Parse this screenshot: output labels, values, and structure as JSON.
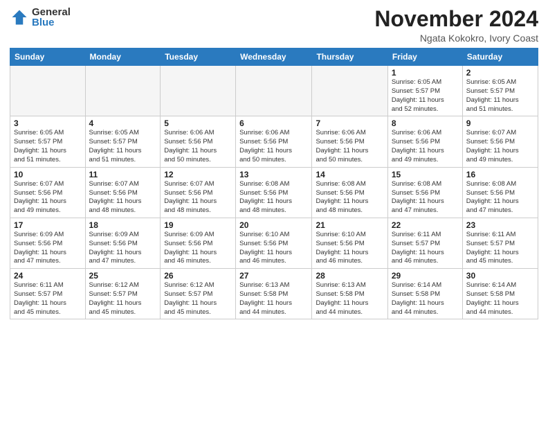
{
  "logo": {
    "general": "General",
    "blue": "Blue"
  },
  "title": "November 2024",
  "location": "Ngata Kokokro, Ivory Coast",
  "weekdays": [
    "Sunday",
    "Monday",
    "Tuesday",
    "Wednesday",
    "Thursday",
    "Friday",
    "Saturday"
  ],
  "weeks": [
    [
      {
        "day": "",
        "info": ""
      },
      {
        "day": "",
        "info": ""
      },
      {
        "day": "",
        "info": ""
      },
      {
        "day": "",
        "info": ""
      },
      {
        "day": "",
        "info": ""
      },
      {
        "day": "1",
        "info": "Sunrise: 6:05 AM\nSunset: 5:57 PM\nDaylight: 11 hours\nand 52 minutes."
      },
      {
        "day": "2",
        "info": "Sunrise: 6:05 AM\nSunset: 5:57 PM\nDaylight: 11 hours\nand 51 minutes."
      }
    ],
    [
      {
        "day": "3",
        "info": "Sunrise: 6:05 AM\nSunset: 5:57 PM\nDaylight: 11 hours\nand 51 minutes."
      },
      {
        "day": "4",
        "info": "Sunrise: 6:05 AM\nSunset: 5:57 PM\nDaylight: 11 hours\nand 51 minutes."
      },
      {
        "day": "5",
        "info": "Sunrise: 6:06 AM\nSunset: 5:56 PM\nDaylight: 11 hours\nand 50 minutes."
      },
      {
        "day": "6",
        "info": "Sunrise: 6:06 AM\nSunset: 5:56 PM\nDaylight: 11 hours\nand 50 minutes."
      },
      {
        "day": "7",
        "info": "Sunrise: 6:06 AM\nSunset: 5:56 PM\nDaylight: 11 hours\nand 50 minutes."
      },
      {
        "day": "8",
        "info": "Sunrise: 6:06 AM\nSunset: 5:56 PM\nDaylight: 11 hours\nand 49 minutes."
      },
      {
        "day": "9",
        "info": "Sunrise: 6:07 AM\nSunset: 5:56 PM\nDaylight: 11 hours\nand 49 minutes."
      }
    ],
    [
      {
        "day": "10",
        "info": "Sunrise: 6:07 AM\nSunset: 5:56 PM\nDaylight: 11 hours\nand 49 minutes."
      },
      {
        "day": "11",
        "info": "Sunrise: 6:07 AM\nSunset: 5:56 PM\nDaylight: 11 hours\nand 48 minutes."
      },
      {
        "day": "12",
        "info": "Sunrise: 6:07 AM\nSunset: 5:56 PM\nDaylight: 11 hours\nand 48 minutes."
      },
      {
        "day": "13",
        "info": "Sunrise: 6:08 AM\nSunset: 5:56 PM\nDaylight: 11 hours\nand 48 minutes."
      },
      {
        "day": "14",
        "info": "Sunrise: 6:08 AM\nSunset: 5:56 PM\nDaylight: 11 hours\nand 48 minutes."
      },
      {
        "day": "15",
        "info": "Sunrise: 6:08 AM\nSunset: 5:56 PM\nDaylight: 11 hours\nand 47 minutes."
      },
      {
        "day": "16",
        "info": "Sunrise: 6:08 AM\nSunset: 5:56 PM\nDaylight: 11 hours\nand 47 minutes."
      }
    ],
    [
      {
        "day": "17",
        "info": "Sunrise: 6:09 AM\nSunset: 5:56 PM\nDaylight: 11 hours\nand 47 minutes."
      },
      {
        "day": "18",
        "info": "Sunrise: 6:09 AM\nSunset: 5:56 PM\nDaylight: 11 hours\nand 47 minutes."
      },
      {
        "day": "19",
        "info": "Sunrise: 6:09 AM\nSunset: 5:56 PM\nDaylight: 11 hours\nand 46 minutes."
      },
      {
        "day": "20",
        "info": "Sunrise: 6:10 AM\nSunset: 5:56 PM\nDaylight: 11 hours\nand 46 minutes."
      },
      {
        "day": "21",
        "info": "Sunrise: 6:10 AM\nSunset: 5:56 PM\nDaylight: 11 hours\nand 46 minutes."
      },
      {
        "day": "22",
        "info": "Sunrise: 6:11 AM\nSunset: 5:57 PM\nDaylight: 11 hours\nand 46 minutes."
      },
      {
        "day": "23",
        "info": "Sunrise: 6:11 AM\nSunset: 5:57 PM\nDaylight: 11 hours\nand 45 minutes."
      }
    ],
    [
      {
        "day": "24",
        "info": "Sunrise: 6:11 AM\nSunset: 5:57 PM\nDaylight: 11 hours\nand 45 minutes."
      },
      {
        "day": "25",
        "info": "Sunrise: 6:12 AM\nSunset: 5:57 PM\nDaylight: 11 hours\nand 45 minutes."
      },
      {
        "day": "26",
        "info": "Sunrise: 6:12 AM\nSunset: 5:57 PM\nDaylight: 11 hours\nand 45 minutes."
      },
      {
        "day": "27",
        "info": "Sunrise: 6:13 AM\nSunset: 5:58 PM\nDaylight: 11 hours\nand 44 minutes."
      },
      {
        "day": "28",
        "info": "Sunrise: 6:13 AM\nSunset: 5:58 PM\nDaylight: 11 hours\nand 44 minutes."
      },
      {
        "day": "29",
        "info": "Sunrise: 6:14 AM\nSunset: 5:58 PM\nDaylight: 11 hours\nand 44 minutes."
      },
      {
        "day": "30",
        "info": "Sunrise: 6:14 AM\nSunset: 5:58 PM\nDaylight: 11 hours\nand 44 minutes."
      }
    ]
  ]
}
